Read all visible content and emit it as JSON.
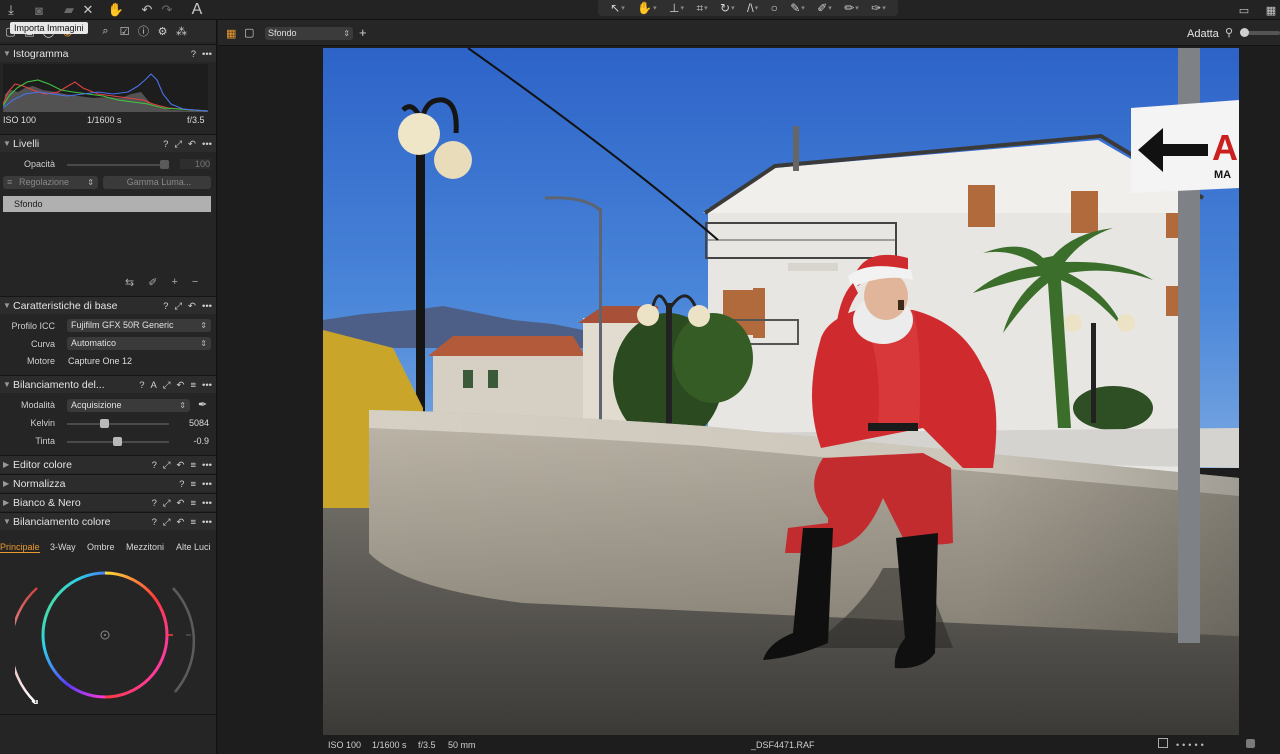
{
  "tooltip": "Importa Immagini",
  "colors": {
    "accent": "#e89a2f",
    "panel": "#252525",
    "header": "#2c2c2c"
  },
  "topbar": {
    "left_icons": [
      "download-icon",
      "camera-icon",
      "folder-icon",
      "close-icon",
      "hand-undo-icon",
      "undo-icon",
      "redo-icon",
      "text-icon"
    ],
    "center_tools": [
      "cursor-icon",
      "pan-hand-icon",
      "stamp-icon",
      "crop-icon",
      "rotate-icon",
      "keystone-icon",
      "circle-icon",
      "color-picker-icon",
      "brush-icon",
      "eraser-icon",
      "pen-icon"
    ],
    "right_icons": [
      "edit-icon",
      "grid-icon"
    ]
  },
  "istogramma": {
    "title": "Istogramma",
    "iso": "ISO 100",
    "shutter": "1/1600 s",
    "aperture": "f/3.5"
  },
  "livelli": {
    "title": "Livelli",
    "opacity_label": "Opacità",
    "opacity_value": "100",
    "regolazione": "Regolazione",
    "gamma": "Gamma Luma...",
    "layer": "Sfondo"
  },
  "caratteristiche": {
    "title": "Caratteristiche di base",
    "profile_label": "Profilo ICC",
    "profile_value": "Fujifilm GFX 50R Generic",
    "curve_label": "Curva",
    "curve_value": "Automatico",
    "engine_label": "Motore",
    "engine_value": "Capture One 12"
  },
  "bilanciamento": {
    "title": "Bilanciamento del...",
    "mode_label": "Modalità",
    "mode_value": "Acquisizione",
    "kelvin_label": "Kelvin",
    "kelvin_value": "5084",
    "kelvin_fraction": 0.35,
    "tint_label": "Tinta",
    "tint_value": "-0.9",
    "tint_fraction": 0.49
  },
  "collapsed_tools": [
    "Editor colore",
    "Normalizza",
    "Bianco & Nero"
  ],
  "color_balance": {
    "title": "Bilanciamento colore",
    "tabs": [
      "Principale",
      "3-Way",
      "Ombre",
      "Mezzitoni",
      "Alte Luci"
    ],
    "active_tab": "Principale"
  },
  "viewer": {
    "variant": "Sfondo",
    "fit_label": "Adatta"
  },
  "photo": {
    "sign_letters": "A",
    "sign_sub": "MA"
  },
  "status": {
    "iso": "ISO 100",
    "shutter": "1/1600 s",
    "aperture": "f/3.5",
    "focal": "50 mm",
    "filename": "_DSF4471.RAF"
  }
}
